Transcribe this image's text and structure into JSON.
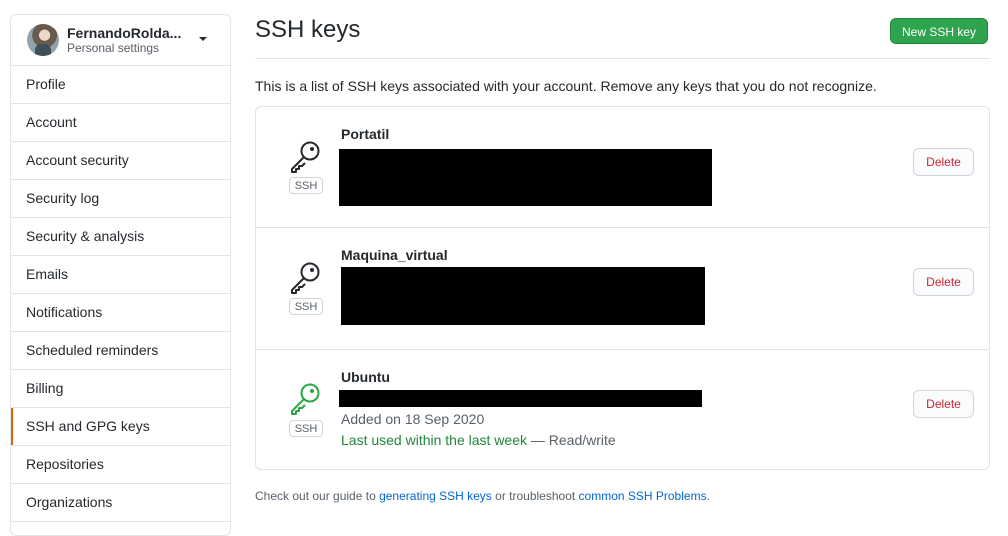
{
  "sidebar": {
    "user": {
      "name": "FernandoRolda...",
      "subtitle": "Personal settings"
    },
    "items": [
      {
        "label": "Profile"
      },
      {
        "label": "Account"
      },
      {
        "label": "Account security"
      },
      {
        "label": "Security log"
      },
      {
        "label": "Security & analysis"
      },
      {
        "label": "Emails"
      },
      {
        "label": "Notifications"
      },
      {
        "label": "Scheduled reminders"
      },
      {
        "label": "Billing"
      },
      {
        "label": "SSH and GPG keys",
        "selected": true
      },
      {
        "label": "Repositories"
      },
      {
        "label": "Organizations"
      }
    ]
  },
  "main": {
    "title": "SSH keys",
    "new_key_label": "New SSH key",
    "description": "This is a list of SSH keys associated with your account. Remove any keys that you do not recognize.",
    "keys": [
      {
        "name": "Portatil",
        "badge": "SSH",
        "delete_label": "Delete",
        "icon": "key-icon",
        "icon_color": "#24292e"
      },
      {
        "name": "Maquina_virtual",
        "badge": "SSH",
        "delete_label": "Delete",
        "icon": "key-icon",
        "icon_color": "#24292e"
      },
      {
        "name": "Ubuntu",
        "badge": "SSH",
        "delete_label": "Delete",
        "icon": "key-icon",
        "icon_color": "#28a745",
        "added": "Added on 18 Sep 2020",
        "last_used": "Last used within the last week",
        "access": " — Read/write"
      }
    ],
    "footer": {
      "prefix": "Check out our guide to ",
      "link1": "generating SSH keys",
      "middle": " or troubleshoot ",
      "link2": "common SSH Problems",
      "suffix": "."
    }
  },
  "colors": {
    "accent_green": "#2ea44f",
    "danger": "#cb2431",
    "selected_marker": "#e36209",
    "link": "#0366d6"
  }
}
